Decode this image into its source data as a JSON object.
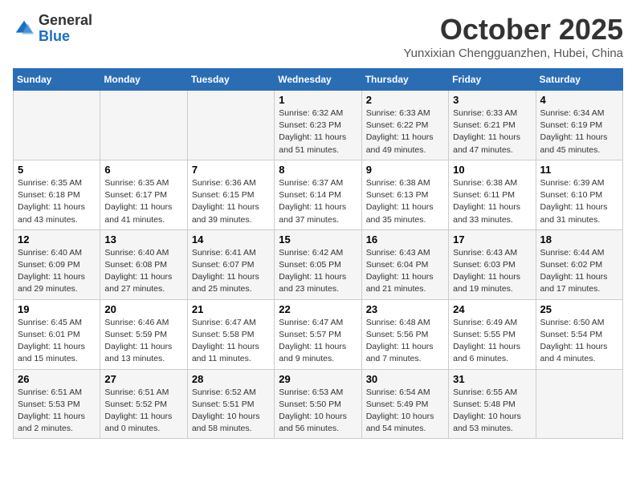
{
  "header": {
    "logo_general": "General",
    "logo_blue": "Blue",
    "title": "October 2025",
    "subtitle": "Yunxixian Chengguanzhen, Hubei, China"
  },
  "weekdays": [
    "Sunday",
    "Monday",
    "Tuesday",
    "Wednesday",
    "Thursday",
    "Friday",
    "Saturday"
  ],
  "weeks": [
    [
      {
        "day": "",
        "info": ""
      },
      {
        "day": "",
        "info": ""
      },
      {
        "day": "",
        "info": ""
      },
      {
        "day": "1",
        "info": "Sunrise: 6:32 AM\nSunset: 6:23 PM\nDaylight: 11 hours and 51 minutes."
      },
      {
        "day": "2",
        "info": "Sunrise: 6:33 AM\nSunset: 6:22 PM\nDaylight: 11 hours and 49 minutes."
      },
      {
        "day": "3",
        "info": "Sunrise: 6:33 AM\nSunset: 6:21 PM\nDaylight: 11 hours and 47 minutes."
      },
      {
        "day": "4",
        "info": "Sunrise: 6:34 AM\nSunset: 6:19 PM\nDaylight: 11 hours and 45 minutes."
      }
    ],
    [
      {
        "day": "5",
        "info": "Sunrise: 6:35 AM\nSunset: 6:18 PM\nDaylight: 11 hours and 43 minutes."
      },
      {
        "day": "6",
        "info": "Sunrise: 6:35 AM\nSunset: 6:17 PM\nDaylight: 11 hours and 41 minutes."
      },
      {
        "day": "7",
        "info": "Sunrise: 6:36 AM\nSunset: 6:15 PM\nDaylight: 11 hours and 39 minutes."
      },
      {
        "day": "8",
        "info": "Sunrise: 6:37 AM\nSunset: 6:14 PM\nDaylight: 11 hours and 37 minutes."
      },
      {
        "day": "9",
        "info": "Sunrise: 6:38 AM\nSunset: 6:13 PM\nDaylight: 11 hours and 35 minutes."
      },
      {
        "day": "10",
        "info": "Sunrise: 6:38 AM\nSunset: 6:11 PM\nDaylight: 11 hours and 33 minutes."
      },
      {
        "day": "11",
        "info": "Sunrise: 6:39 AM\nSunset: 6:10 PM\nDaylight: 11 hours and 31 minutes."
      }
    ],
    [
      {
        "day": "12",
        "info": "Sunrise: 6:40 AM\nSunset: 6:09 PM\nDaylight: 11 hours and 29 minutes."
      },
      {
        "day": "13",
        "info": "Sunrise: 6:40 AM\nSunset: 6:08 PM\nDaylight: 11 hours and 27 minutes."
      },
      {
        "day": "14",
        "info": "Sunrise: 6:41 AM\nSunset: 6:07 PM\nDaylight: 11 hours and 25 minutes."
      },
      {
        "day": "15",
        "info": "Sunrise: 6:42 AM\nSunset: 6:05 PM\nDaylight: 11 hours and 23 minutes."
      },
      {
        "day": "16",
        "info": "Sunrise: 6:43 AM\nSunset: 6:04 PM\nDaylight: 11 hours and 21 minutes."
      },
      {
        "day": "17",
        "info": "Sunrise: 6:43 AM\nSunset: 6:03 PM\nDaylight: 11 hours and 19 minutes."
      },
      {
        "day": "18",
        "info": "Sunrise: 6:44 AM\nSunset: 6:02 PM\nDaylight: 11 hours and 17 minutes."
      }
    ],
    [
      {
        "day": "19",
        "info": "Sunrise: 6:45 AM\nSunset: 6:01 PM\nDaylight: 11 hours and 15 minutes."
      },
      {
        "day": "20",
        "info": "Sunrise: 6:46 AM\nSunset: 5:59 PM\nDaylight: 11 hours and 13 minutes."
      },
      {
        "day": "21",
        "info": "Sunrise: 6:47 AM\nSunset: 5:58 PM\nDaylight: 11 hours and 11 minutes."
      },
      {
        "day": "22",
        "info": "Sunrise: 6:47 AM\nSunset: 5:57 PM\nDaylight: 11 hours and 9 minutes."
      },
      {
        "day": "23",
        "info": "Sunrise: 6:48 AM\nSunset: 5:56 PM\nDaylight: 11 hours and 7 minutes."
      },
      {
        "day": "24",
        "info": "Sunrise: 6:49 AM\nSunset: 5:55 PM\nDaylight: 11 hours and 6 minutes."
      },
      {
        "day": "25",
        "info": "Sunrise: 6:50 AM\nSunset: 5:54 PM\nDaylight: 11 hours and 4 minutes."
      }
    ],
    [
      {
        "day": "26",
        "info": "Sunrise: 6:51 AM\nSunset: 5:53 PM\nDaylight: 11 hours and 2 minutes."
      },
      {
        "day": "27",
        "info": "Sunrise: 6:51 AM\nSunset: 5:52 PM\nDaylight: 11 hours and 0 minutes."
      },
      {
        "day": "28",
        "info": "Sunrise: 6:52 AM\nSunset: 5:51 PM\nDaylight: 10 hours and 58 minutes."
      },
      {
        "day": "29",
        "info": "Sunrise: 6:53 AM\nSunset: 5:50 PM\nDaylight: 10 hours and 56 minutes."
      },
      {
        "day": "30",
        "info": "Sunrise: 6:54 AM\nSunset: 5:49 PM\nDaylight: 10 hours and 54 minutes."
      },
      {
        "day": "31",
        "info": "Sunrise: 6:55 AM\nSunset: 5:48 PM\nDaylight: 10 hours and 53 minutes."
      },
      {
        "day": "",
        "info": ""
      }
    ]
  ]
}
